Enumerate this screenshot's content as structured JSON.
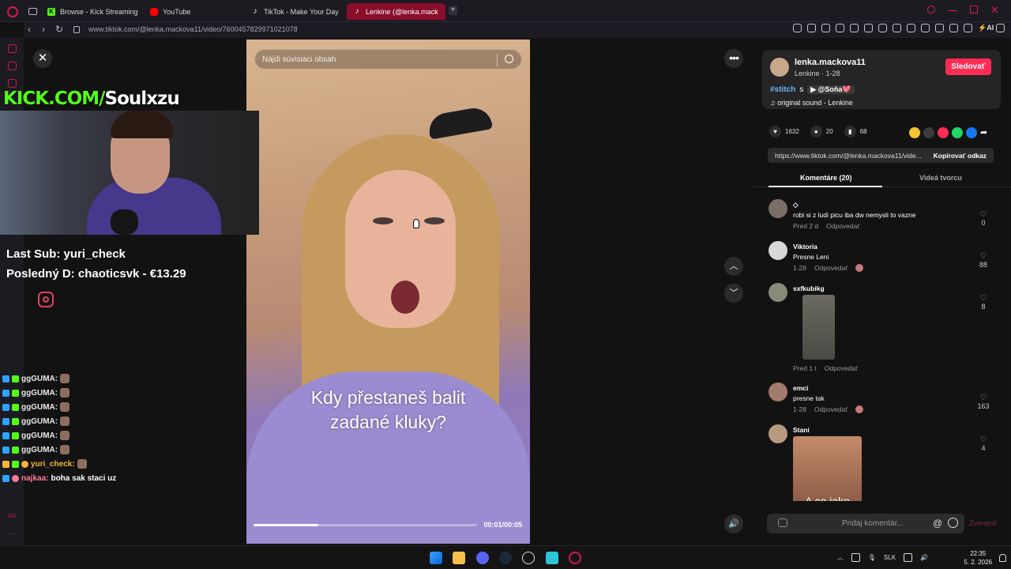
{
  "browser": {
    "tabs": [
      {
        "label": "Browse - Kick Streaming",
        "icon": "kick-icon"
      },
      {
        "label": "YouTube",
        "icon": "youtube-icon"
      },
      {
        "label": "TikTok - Make Your Day",
        "icon": "tiktok-icon"
      },
      {
        "label": "Lenkine (@lenka.mack",
        "icon": "tiktok-icon",
        "active": true
      }
    ],
    "url": "www.tiktok.com/@lenka.mackova11/video/7600457829971021078"
  },
  "overlay": {
    "kick_prefix": "KICK.COM/",
    "kick_name": "Soulxzu",
    "last_sub": "Last Sub: yuri_check",
    "last_donation": "Posledný D: chaoticsvk - €13.29",
    "chat": [
      {
        "user": "ggGUMA:",
        "msg": "",
        "color": "default"
      },
      {
        "user": "ggGUMA:",
        "msg": "",
        "color": "default"
      },
      {
        "user": "ggGUMA:",
        "msg": "",
        "color": "default"
      },
      {
        "user": "ggGUMA:",
        "msg": "",
        "color": "default"
      },
      {
        "user": "ggGUMA:",
        "msg": "",
        "color": "default"
      },
      {
        "user": "ggGUMA:",
        "msg": "",
        "color": "default"
      },
      {
        "user": "yuri_check:",
        "msg": "",
        "color": "gold"
      },
      {
        "user": "najkaa:",
        "msg": "boha sak staci uz",
        "color": "red"
      }
    ]
  },
  "video": {
    "search_placeholder": "Nájdi súvisiaci obsah",
    "caption_line1": "Kdy přestaneš balit",
    "caption_line2": "zadané kluky?",
    "time": "00:01/00:05",
    "progress": 0.29
  },
  "author": {
    "username": "lenka.mackova11",
    "subtitle": "Lenkine · 1-28",
    "follow_label": "Sledovať",
    "hashtag": "#stitch",
    "desc_word": "s",
    "mention": "▶ @Soňa💖",
    "sound": "original sound - Lenkine"
  },
  "stats": {
    "likes": "1632",
    "comments": "20",
    "saves": "68"
  },
  "share": {
    "link": "https://www.tiktok.com/@lenka.mackova11/vide...",
    "copy_label": "Kopírovať odkaz"
  },
  "tabs": {
    "comments": "Komentáre (20)",
    "creator_videos": "Videá tvorcu"
  },
  "comments": [
    {
      "user": "◇",
      "text": "robi si z ludi picu iba dw nemysli to vazne",
      "date": "Pred 2 d",
      "reply": "Odpovedať",
      "likes": "0"
    },
    {
      "user": "Viktoria",
      "text": "Presne Leni",
      "date": "1-28",
      "reply": "Odpovedať",
      "likes": "88"
    },
    {
      "user": "sxfkubikg",
      "text": "",
      "date": "Pred 1 t",
      "reply": "Odpovedať",
      "likes": "8"
    },
    {
      "user": "emci",
      "text": "presne tak",
      "date": "1-28",
      "reply": "Odpovedať",
      "likes": "163"
    },
    {
      "user": "Stani",
      "text": "",
      "image_text": "A co jako",
      "date": "",
      "reply": "",
      "likes": "4"
    }
  ],
  "comment_input": {
    "placeholder": "Pridaj komentár...",
    "post_label": "Zverejniť"
  },
  "taskbar": {
    "lang": "SLK",
    "time": "22:35",
    "date": "5. 2. 2026"
  }
}
